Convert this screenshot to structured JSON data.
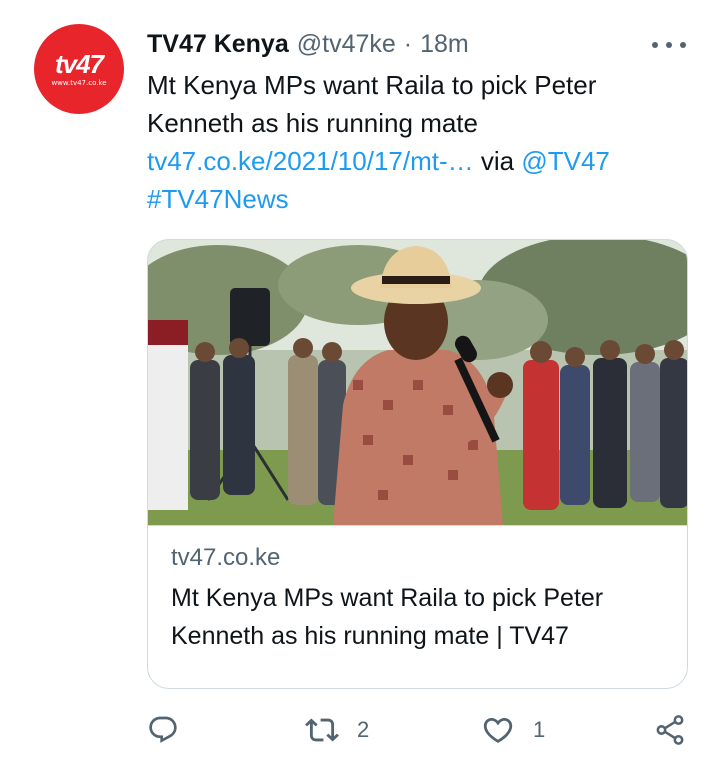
{
  "tweet": {
    "avatar": {
      "logo": "tv47",
      "url_text": "www.tv47.co.ke",
      "color": "#e8252b"
    },
    "author_name": "TV47 Kenya",
    "handle": "@tv47ke",
    "separator": "·",
    "time": "18m",
    "more_icon": "more-horizontal-icon",
    "text_line": "Mt Kenya MPs want Raila to pick Peter Kenneth as his running mate",
    "link": "tv47.co.ke/2021/10/17/mt-…",
    "via": "via",
    "mention": "@TV47",
    "hashtag": "#TV47News"
  },
  "card": {
    "image_alt": "Man in straw hat and patterned shirt speaking into a microphone outdoors with a crowd behind",
    "domain": "tv47.co.ke",
    "title": "Mt Kenya MPs want Raila to pick Peter Kenneth as his running mate | TV47"
  },
  "actions": {
    "reply": {
      "icon": "reply-icon",
      "count": ""
    },
    "retweet": {
      "icon": "retweet-icon",
      "count": "2"
    },
    "like": {
      "icon": "heart-icon",
      "count": "1"
    },
    "share": {
      "icon": "share-icon",
      "count": ""
    }
  },
  "colors": {
    "link": "#1d9bf0",
    "muted": "#536471",
    "text": "#0f1419",
    "border": "#cfd9de"
  }
}
